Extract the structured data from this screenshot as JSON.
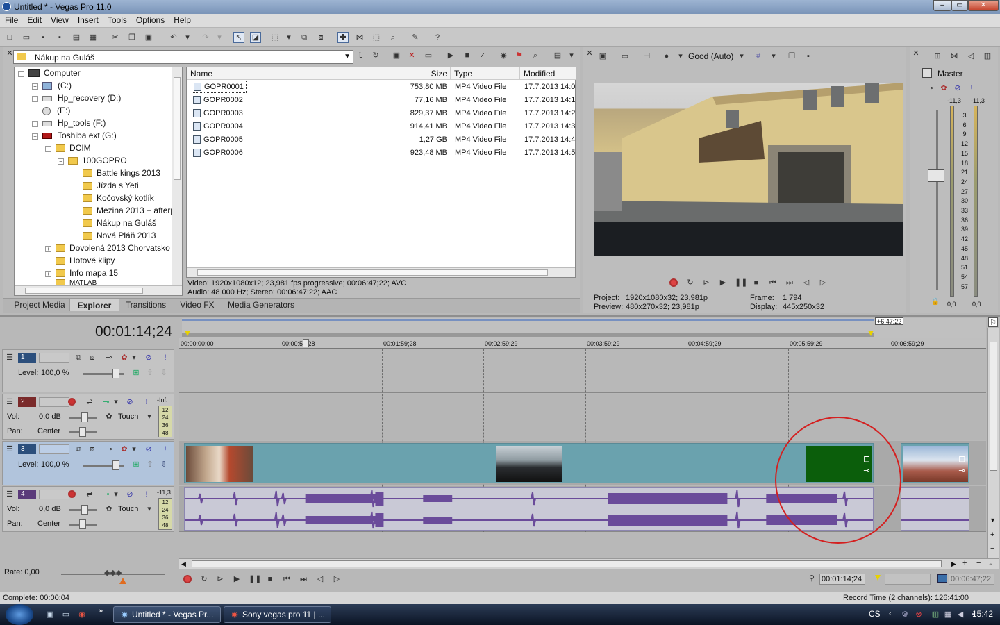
{
  "window": {
    "title": "Untitled * - Vegas Pro 11.0",
    "controls": [
      "minimize",
      "maximize",
      "close"
    ]
  },
  "menu": [
    "File",
    "Edit",
    "View",
    "Insert",
    "Tools",
    "Options",
    "Help"
  ],
  "explorer": {
    "path": "Nákup na Guláš",
    "tree": [
      {
        "label": "Computer",
        "icon": "computer-icon"
      },
      {
        "label": "(C:)",
        "icon": "drive-icon"
      },
      {
        "label": "Hp_recovery (D:)",
        "icon": "drive-icon"
      },
      {
        "label": "(E:)",
        "icon": "dvd-icon"
      },
      {
        "label": "Hp_tools (F:)",
        "icon": "drive-icon"
      },
      {
        "label": "Toshiba ext (G:)",
        "icon": "drive-icon"
      },
      {
        "label": "DCIM",
        "icon": "folder-icon"
      },
      {
        "label": "100GOPRO",
        "icon": "folder-icon"
      },
      {
        "label": "Battle kings 2013",
        "icon": "folder-icon"
      },
      {
        "label": "Jízda s Yeti",
        "icon": "folder-icon"
      },
      {
        "label": "Kočovský kotlík",
        "icon": "folder-icon"
      },
      {
        "label": "Mezina 2013 + afterp",
        "icon": "folder-icon"
      },
      {
        "label": "Nákup na Guláš",
        "icon": "folder-icon"
      },
      {
        "label": "Nová Pláň 2013",
        "icon": "folder-icon"
      },
      {
        "label": "Dovolená 2013 Chorvatsko",
        "icon": "folder-icon"
      },
      {
        "label": "Hotové klipy",
        "icon": "folder-icon"
      },
      {
        "label": "Info mapa 15",
        "icon": "folder-icon"
      },
      {
        "label": "MATLAB",
        "icon": "folder-icon"
      }
    ],
    "columns": [
      "Name",
      "Size",
      "Type",
      "Modified"
    ],
    "files": [
      {
        "name": "GOPR0001",
        "size": "753,80 MB",
        "type": "MP4 Video File",
        "modified": "17.7.2013 14:0"
      },
      {
        "name": "GOPR0002",
        "size": "77,16 MB",
        "type": "MP4 Video File",
        "modified": "17.7.2013 14:1"
      },
      {
        "name": "GOPR0003",
        "size": "829,37 MB",
        "type": "MP4 Video File",
        "modified": "17.7.2013 14:2"
      },
      {
        "name": "GOPR0004",
        "size": "914,41 MB",
        "type": "MP4 Video File",
        "modified": "17.7.2013 14:3"
      },
      {
        "name": "GOPR0005",
        "size": "1,27 GB",
        "type": "MP4 Video File",
        "modified": "17.7.2013 14:4"
      },
      {
        "name": "GOPR0006",
        "size": "923,48 MB",
        "type": "MP4 Video File",
        "modified": "17.7.2013 14:5"
      }
    ],
    "info_video": "Video: 1920x1080x12; 23,981 fps progressive; 00:06:47;22; AVC",
    "info_audio": "Audio: 48 000 Hz; Stereo; 00:06:47;22; AAC",
    "tabs": [
      "Project Media",
      "Explorer",
      "Transitions",
      "Video FX",
      "Media Generators"
    ],
    "active_tab": "Explorer"
  },
  "preview": {
    "quality": "Good (Auto)",
    "project_label": "Project:",
    "project_value": "1920x1080x32; 23,981p",
    "preview_label": "Preview:",
    "preview_value": "480x270x32; 23,981p",
    "frame_label": "Frame:",
    "frame_value": "1 794",
    "display_label": "Display:",
    "display_value": "445x250x32"
  },
  "master": {
    "label": "Master",
    "peak_left": "-11,3",
    "peak_right": "-11,3",
    "scale": [
      "3",
      "6",
      "9",
      "12",
      "15",
      "18",
      "21",
      "24",
      "27",
      "30",
      "33",
      "36",
      "39",
      "42",
      "45",
      "48",
      "51",
      "54",
      "57"
    ],
    "bottom_left": "0,0",
    "bottom_right": "0,0"
  },
  "timeline": {
    "timecode": "00:01:14;24",
    "end_marker": "+6:47;22",
    "ruler": [
      "00:00:00;00",
      "00:00:59;28",
      "00:01:59;28",
      "00:02:59;29",
      "00:03:59;29",
      "00:04:59;29",
      "00:05:59;29",
      "00:06:59;29"
    ],
    "tracks": [
      {
        "number": "1",
        "kind": "video",
        "level_label": "Level:",
        "level": "100,0 %"
      },
      {
        "number": "2",
        "kind": "audio",
        "vol_label": "Vol:",
        "vol": "0,0 dB",
        "pan_label": "Pan:",
        "pan": "Center",
        "mode": "Touch",
        "meter_top": "-Inf.",
        "meter_marks": [
          "12",
          "24",
          "36",
          "48"
        ]
      },
      {
        "number": "3",
        "kind": "video",
        "level_label": "Level:",
        "level": "100,0 %"
      },
      {
        "number": "4",
        "kind": "audio",
        "vol_label": "Vol:",
        "vol": "0,0 dB",
        "pan_label": "Pan:",
        "pan": "Center",
        "mode": "Touch",
        "meter_top": "-11,3",
        "meter_marks": [
          "12",
          "24",
          "36",
          "48"
        ]
      }
    ],
    "rate": "Rate: 0,00",
    "cursor_time": "00:01:14;24",
    "end_time": "00:06:47;22"
  },
  "status": {
    "complete": "Complete: 00:00:04",
    "record_time": "Record Time (2 channels): 126:41:00"
  },
  "taskbar": {
    "items": [
      "Untitled * - Vegas Pr...",
      "Sony vegas pro 11 | ..."
    ],
    "lang": "CS",
    "clock": "15:42"
  }
}
